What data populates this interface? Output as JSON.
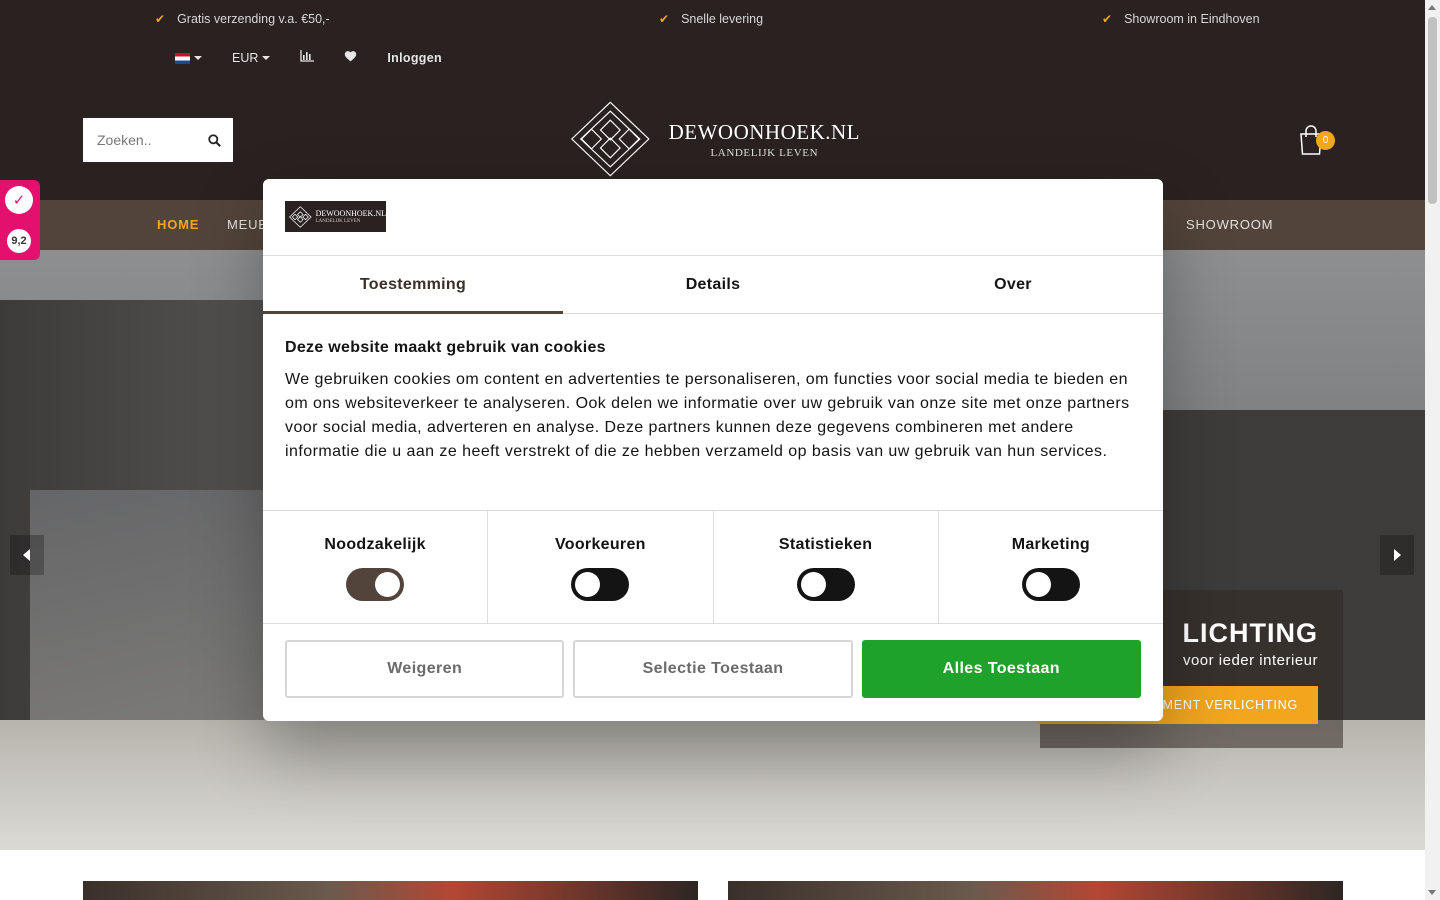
{
  "usps": [
    {
      "icon": "check-icon",
      "text": "Gratis verzending v.a. €50,-"
    },
    {
      "icon": "check-icon",
      "text": "Snelle levering"
    },
    {
      "icon": "check-icon",
      "text": "Showroom in Eindhoven"
    }
  ],
  "toolbar": {
    "language_icon": "nl-flag-icon",
    "currency": "EUR",
    "compare_icon": "bar-chart-icon",
    "wishlist_icon": "heart-icon",
    "login": "Inloggen"
  },
  "search": {
    "placeholder": "Zoeken.."
  },
  "logo": {
    "name": "DEWOONHOEK.NL",
    "tagline": "LANDELIJK LEVEN"
  },
  "cart": {
    "count": "0"
  },
  "nav": {
    "home": "HOME",
    "meubels_partial": "MEUB",
    "showroom": "SHOWROOM"
  },
  "hero": {
    "title_partial": "LICHTING",
    "subtitle_partial": "voor ieder interieur",
    "button_partial": "MENT VERLICHTING"
  },
  "rating": {
    "score": "9,2"
  },
  "cookie": {
    "tabs": [
      "Toestemming",
      "Details",
      "Over"
    ],
    "heading": "Deze website maakt gebruik van cookies",
    "body": "We gebruiken cookies om content en advertenties te personaliseren, om functies voor social media te bieden en om ons websiteverkeer te analyseren. Ook delen we informatie over uw gebruik van onze site met onze partners voor social media, adverteren en analyse. Deze partners kunnen deze gegevens combineren met andere informatie die u aan ze heeft verstrekt of die ze hebben verzameld op basis van uw gebruik van hun services.",
    "categories": [
      {
        "label": "Noodzakelijk",
        "checked": true
      },
      {
        "label": "Voorkeuren",
        "checked": false
      },
      {
        "label": "Statistieken",
        "checked": false
      },
      {
        "label": "Marketing",
        "checked": false
      }
    ],
    "buttons": {
      "decline": "Weigeren",
      "allow_selection": "Selectie Toestaan",
      "allow_all": "Alles Toestaan"
    }
  },
  "colors": {
    "accent": "#f2a61e",
    "header_bg": "#2a2121",
    "nav_bg": "#52443a",
    "allow_all": "#1fa22b",
    "rating": "#e3106e"
  }
}
